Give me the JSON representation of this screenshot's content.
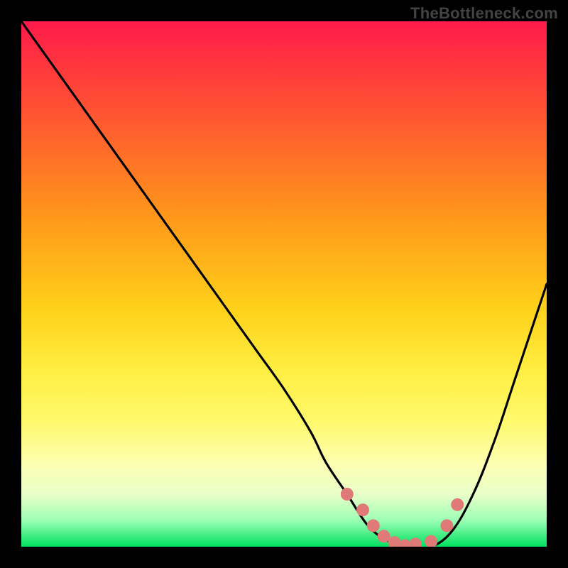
{
  "watermark": "TheBottleneck.com",
  "colors": {
    "background": "#000000",
    "curve": "#000000",
    "marker_fill": "#e07a78",
    "marker_stroke": "#b85a58",
    "gradient_top": "#ff1a4b",
    "gradient_bottom": "#00e060"
  },
  "chart_data": {
    "type": "line",
    "title": "",
    "xlabel": "",
    "ylabel": "",
    "xlim": [
      0,
      100
    ],
    "ylim": [
      0,
      100
    ],
    "grid": false,
    "series": [
      {
        "name": "bottleneck-curve",
        "x": [
          0,
          5,
          10,
          15,
          20,
          25,
          30,
          35,
          40,
          45,
          50,
          55,
          58,
          62,
          66,
          70,
          74,
          78,
          82,
          86,
          90,
          94,
          98,
          100
        ],
        "values": [
          100,
          93,
          86,
          79,
          72,
          65,
          58,
          51,
          44,
          37,
          30,
          22,
          16,
          10,
          4,
          1,
          0,
          0,
          3,
          10,
          20,
          32,
          44,
          50
        ]
      }
    ],
    "markers": {
      "name": "optimal-range-dots",
      "x": [
        62,
        65,
        67,
        69,
        71,
        73,
        75,
        78,
        81,
        83
      ],
      "values": [
        10,
        7,
        4,
        2,
        0.8,
        0.2,
        0.5,
        1,
        4,
        8
      ]
    }
  }
}
